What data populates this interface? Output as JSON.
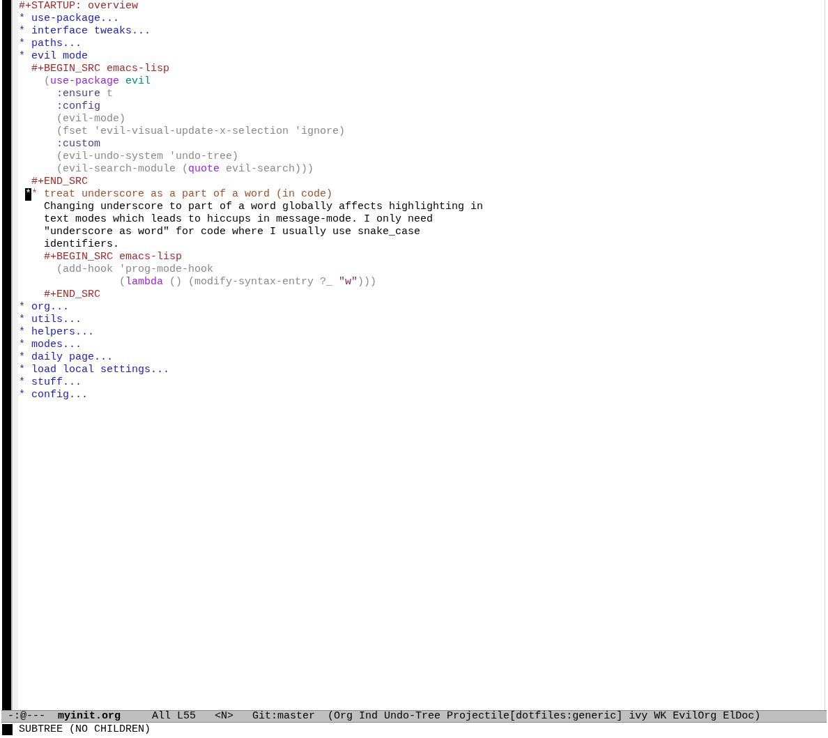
{
  "buffer_lines": [
    {
      "segments": [
        {
          "text": "#+STARTUP: overview",
          "kind": "meta"
        }
      ]
    },
    {
      "segments": [
        {
          "text": "* use-package...",
          "kind": "heading1"
        }
      ]
    },
    {
      "segments": [
        {
          "text": "* interface tweaks...",
          "kind": "heading1"
        }
      ]
    },
    {
      "segments": [
        {
          "text": "* paths...",
          "kind": "heading1"
        }
      ]
    },
    {
      "segments": [
        {
          "text": "* evil mode",
          "kind": "heading1"
        }
      ]
    },
    {
      "segments": [
        {
          "text": "  #+BEGIN_SRC emacs-lisp",
          "kind": "meta"
        }
      ]
    },
    {
      "segments": [
        {
          "text": "    (",
          "kind": "code"
        },
        {
          "text": "use-package",
          "kind": "keyword"
        },
        {
          "text": " evil",
          "kind": "constant"
        }
      ]
    },
    {
      "segments": [
        {
          "text": "      :ensure",
          "kind": "builtin"
        },
        {
          "text": " t",
          "kind": "code"
        }
      ]
    },
    {
      "segments": [
        {
          "text": "      :config",
          "kind": "builtin"
        }
      ]
    },
    {
      "segments": [
        {
          "text": "      (evil-mode)",
          "kind": "code"
        }
      ]
    },
    {
      "segments": [
        {
          "text": "      (fset 'evil-visual-update-x-selection 'ignore)",
          "kind": "code"
        }
      ]
    },
    {
      "segments": [
        {
          "text": "      :custom",
          "kind": "builtin"
        }
      ]
    },
    {
      "segments": [
        {
          "text": "      (evil-undo-system 'undo-tree)",
          "kind": "code"
        }
      ]
    },
    {
      "segments": [
        {
          "text": "      (evil-search-module (",
          "kind": "code"
        },
        {
          "text": "quote",
          "kind": "keyword"
        },
        {
          "text": " evil-search)))",
          "kind": "code"
        }
      ]
    },
    {
      "segments": [
        {
          "text": "  #+END_SRC",
          "kind": "meta"
        }
      ]
    },
    {
      "cursor": "*",
      "segments": [
        {
          "text": "* treat underscore as a part of a word (in code)",
          "kind": "heading2"
        }
      ]
    },
    {
      "segments": [
        {
          "text": "    Changing underscore to part of a word globally affects highlighting in",
          "kind": "body"
        }
      ]
    },
    {
      "segments": [
        {
          "text": "    text modes which leads to hiccups in message-mode. I only need",
          "kind": "body"
        }
      ]
    },
    {
      "segments": [
        {
          "text": "    \"underscore as word\" for code where I usually use snake_case",
          "kind": "body"
        }
      ]
    },
    {
      "segments": [
        {
          "text": "    identifiers.",
          "kind": "body"
        }
      ]
    },
    {
      "segments": [
        {
          "text": "    #+BEGIN_SRC emacs-lisp",
          "kind": "meta"
        }
      ]
    },
    {
      "segments": [
        {
          "text": "      (add-hook 'prog-mode-hook",
          "kind": "code"
        }
      ]
    },
    {
      "segments": [
        {
          "text": "                (",
          "kind": "code"
        },
        {
          "text": "lambda",
          "kind": "keyword"
        },
        {
          "text": " () (modify-syntax-entry ?_ ",
          "kind": "code"
        },
        {
          "text": "\"w\"",
          "kind": "string"
        },
        {
          "text": ")))",
          "kind": "code"
        }
      ]
    },
    {
      "segments": [
        {
          "text": "    #+END_SRC",
          "kind": "meta"
        }
      ]
    },
    {
      "segments": [
        {
          "text": "* org...",
          "kind": "heading1"
        }
      ]
    },
    {
      "segments": [
        {
          "text": "* utils...",
          "kind": "heading1"
        }
      ]
    },
    {
      "segments": [
        {
          "text": "* helpers...",
          "kind": "heading1"
        }
      ]
    },
    {
      "segments": [
        {
          "text": "* modes...",
          "kind": "heading1"
        }
      ]
    },
    {
      "segments": [
        {
          "text": "* daily page...",
          "kind": "heading1"
        }
      ]
    },
    {
      "segments": [
        {
          "text": "* load local settings...",
          "kind": "heading1"
        }
      ]
    },
    {
      "segments": [
        {
          "text": "* stuff...",
          "kind": "heading1"
        }
      ]
    },
    {
      "segments": [
        {
          "text": "* config...",
          "kind": "heading1"
        }
      ]
    }
  ],
  "mode_line": [
    {
      "text": "-:@---",
      "bold": false
    },
    {
      "text": "myinit.org",
      "bold": true
    },
    {
      "text": "All L55",
      "bold": false
    },
    {
      "text": "<N>",
      "bold": false
    },
    {
      "text": "Git:master",
      "bold": false
    },
    {
      "text": "(Org Ind Undo-Tree Projectile[dotfiles:generic] ivy WK EvilOrg ElDoc)",
      "bold": false
    }
  ],
  "echo_area": "SUBTREE (NO CHILDREN)"
}
